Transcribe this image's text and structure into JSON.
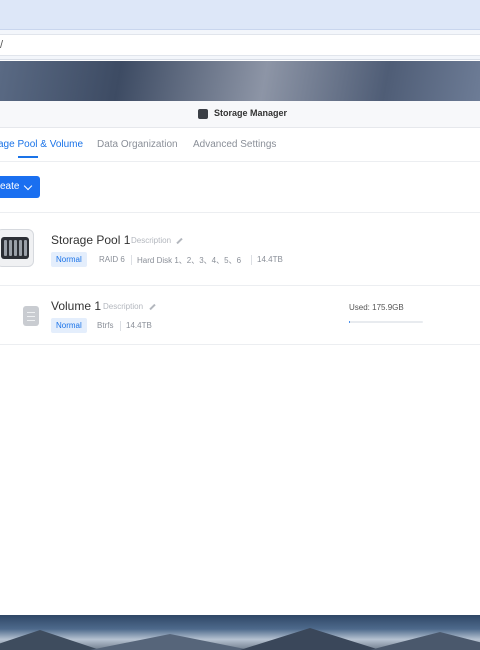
{
  "browser": {
    "url_text": "/"
  },
  "window": {
    "title": "Storage Manager"
  },
  "tabs": [
    {
      "label": "age Pool & Volume",
      "active": true
    },
    {
      "label": "Data Organization",
      "active": false
    },
    {
      "label": "Advanced Settings",
      "active": false
    }
  ],
  "toolbar": {
    "create_label": "eate"
  },
  "pool": {
    "name": "Storage Pool 1",
    "description_placeholder": "Description",
    "status": "Normal",
    "raid": "RAID 6",
    "disks": "Hard Disk 1、2、3、4、5、6",
    "capacity": "14.4TB"
  },
  "volume": {
    "name": "Volume 1",
    "description_placeholder": "Description",
    "status": "Normal",
    "filesystem": "Btrfs",
    "capacity": "14.4TB",
    "used_text": "Used: 175.9GB",
    "used_fraction": 0.012
  },
  "colors": {
    "accent": "#1a73e8",
    "button": "#1a6ff0",
    "badge_bg": "#e4eefc"
  },
  "icons": [
    "app-icon",
    "chevron-down-icon",
    "storage-pool-icon",
    "pencil-icon",
    "volume-icon"
  ]
}
